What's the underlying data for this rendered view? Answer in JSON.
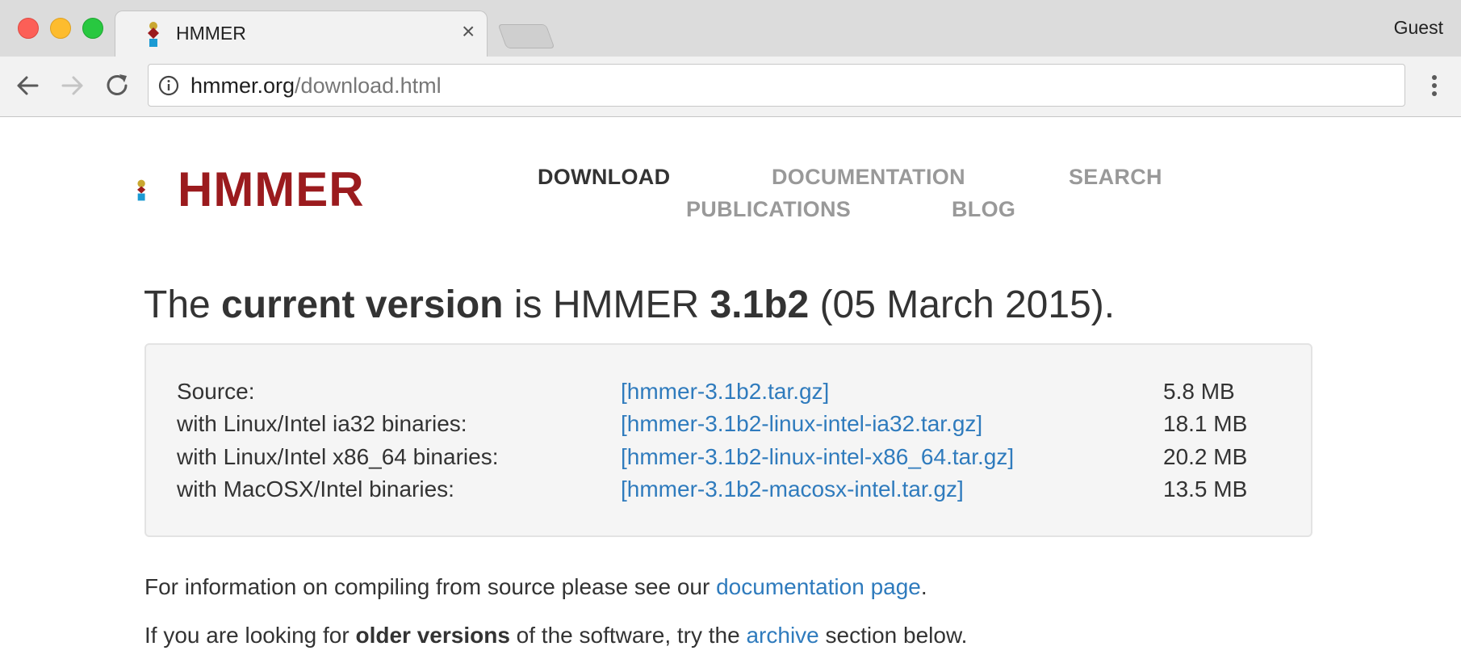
{
  "browser": {
    "tab_title": "HMMER",
    "tab_close": "×",
    "profile": "Guest",
    "url_host": "hmmer.org",
    "url_path": "/download.html"
  },
  "site": {
    "logo_text": "HMMER",
    "nav": {
      "download": "DOWNLOAD",
      "documentation": "DOCUMENTATION",
      "search": "SEARCH",
      "publications": "PUBLICATIONS",
      "blog": "BLOG"
    }
  },
  "headline": {
    "part1": "The ",
    "part2": "current version",
    "part3": " is HMMER ",
    "part4": "3.1b2",
    "part5": " (05 March 2015)."
  },
  "downloads": [
    {
      "label": "Source:",
      "link": "[hmmer-3.1b2.tar.gz]",
      "size": "5.8 MB"
    },
    {
      "label": "with Linux/Intel ia32 binaries:",
      "link": "[hmmer-3.1b2-linux-intel-ia32.tar.gz]",
      "size": "18.1 MB"
    },
    {
      "label": "with Linux/Intel x86_64 binaries:",
      "link": "[hmmer-3.1b2-linux-intel-x86_64.tar.gz]",
      "size": "20.2 MB"
    },
    {
      "label": "with MacOSX/Intel binaries:",
      "link": "[hmmer-3.1b2-macosx-intel.tar.gz]",
      "size": "13.5 MB"
    }
  ],
  "info": {
    "p1_before": "For information on compiling from source please see our ",
    "p1_link": "documentation page",
    "p1_after": ".",
    "p2_before": "If you are looking for ",
    "p2_bold": "older versions",
    "p2_mid": " of the software, try the ",
    "p2_link": "archive",
    "p2_after": " section below."
  },
  "colors": {
    "logo_red": "#9b1b1e",
    "logo_gold": "#c9a730",
    "logo_blue": "#1b9ad3",
    "link_blue": "#2f7bbd"
  }
}
